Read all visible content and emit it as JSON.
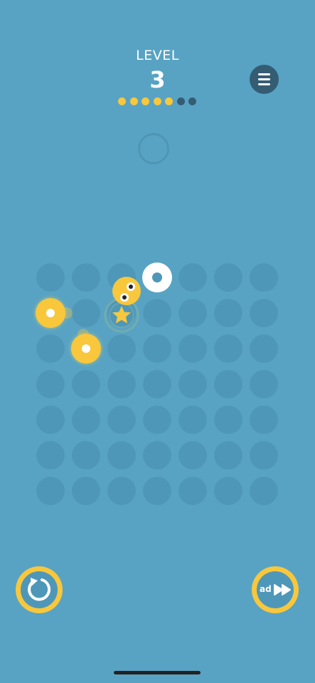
{
  "header": {
    "level_label": "LEVEL",
    "level_number": "3",
    "progress": {
      "total": 7,
      "completed": 5
    }
  },
  "menu": {
    "icon": "hamburger-menu-icon"
  },
  "board": {
    "rows": 7,
    "cols": 7
  },
  "controls": {
    "restart_icon": "restart-icon",
    "skip_ad_label": "ad",
    "skip_icon": "fast-forward-icon"
  },
  "colors": {
    "background": "#58a3c3",
    "cell": "#4f97b8",
    "accent_yellow": "#f8c73c",
    "dark_dot": "#345d73",
    "white": "#ffffff"
  }
}
